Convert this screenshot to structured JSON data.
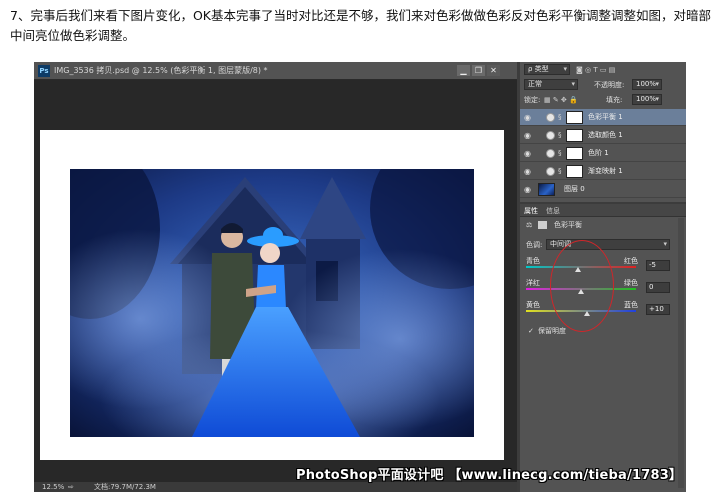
{
  "instruction": "7、完事后我们来看下图片变化，OK基本完事了当时对比还是不够，我们来对色彩做做色彩反对色彩平衡调整调整如图，对暗部中间亮位做色彩调整。",
  "document": {
    "badge": "Ps",
    "title": "IMG_3536 拷贝.psd @ 12.5% (色彩平衡 1, 图层蒙版/8) *",
    "buttons": {
      "minimize": "▁",
      "restore": "❐",
      "close": "✕"
    },
    "zoom": "12.5%",
    "doc_info": "文档:79.7M/72.3M"
  },
  "layers_panel": {
    "kind_label": "ρ 类型",
    "blend_mode": "正常",
    "opacity_label": "不透明度:",
    "opacity_value": "100%",
    "lock_label": "锁定:",
    "fill_label": "填充:",
    "fill_value": "100%",
    "layers": [
      {
        "name": "色彩平衡 1",
        "active": true
      },
      {
        "name": "选取颜色 1",
        "active": false
      },
      {
        "name": "色阶 1",
        "active": false
      },
      {
        "name": "渐变映射 1",
        "active": false
      },
      {
        "name": "图层 0",
        "active": false
      }
    ]
  },
  "properties_panel": {
    "tab_properties": "属性",
    "tab_info": "信息",
    "adjustment_title": "色彩平衡",
    "tone_label": "色调:",
    "tone_value": "中间调",
    "sliders": [
      {
        "left": "青色",
        "right": "红色",
        "value": "-5",
        "level": -5,
        "colors": [
          "#00c8c8",
          "#e02020"
        ]
      },
      {
        "left": "洋红",
        "right": "绿色",
        "value": "0",
        "level": 0,
        "colors": [
          "#e020e0",
          "#20c020"
        ]
      },
      {
        "left": "黄色",
        "right": "蓝色",
        "value": "+10",
        "level": 10,
        "colors": [
          "#e0e020",
          "#2040e0"
        ]
      }
    ],
    "preserve_luminosity_check": "✓",
    "preserve_luminosity": "保留明度"
  },
  "watermark": "PhotoShop平面设计吧 【www.linecg.com/tieba/1783】"
}
